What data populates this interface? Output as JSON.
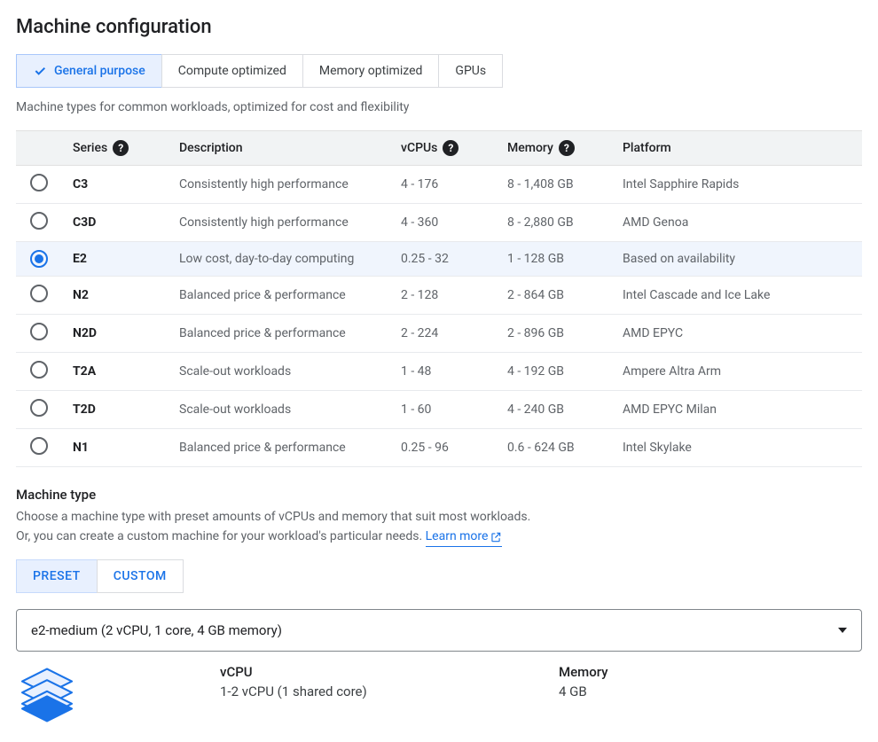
{
  "title": "Machine configuration",
  "tabs": [
    {
      "label": "General purpose",
      "active": true
    },
    {
      "label": "Compute optimized",
      "active": false
    },
    {
      "label": "Memory optimized",
      "active": false
    },
    {
      "label": "GPUs",
      "active": false
    }
  ],
  "subheading": "Machine types for common workloads, optimized for cost and flexibility",
  "table": {
    "headers": {
      "series": "Series",
      "description": "Description",
      "vcpus": "vCPUs",
      "memory": "Memory",
      "platform": "Platform"
    },
    "rows": [
      {
        "series": "C3",
        "description": "Consistently high performance",
        "vcpus": "4 - 176",
        "memory": "8 - 1,408 GB",
        "platform": "Intel Sapphire Rapids",
        "selected": false
      },
      {
        "series": "C3D",
        "description": "Consistently high performance",
        "vcpus": "4 - 360",
        "memory": "8 - 2,880 GB",
        "platform": "AMD Genoa",
        "selected": false
      },
      {
        "series": "E2",
        "description": "Low cost, day-to-day computing",
        "vcpus": "0.25 - 32",
        "memory": "1 - 128 GB",
        "platform": "Based on availability",
        "selected": true
      },
      {
        "series": "N2",
        "description": "Balanced price & performance",
        "vcpus": "2 - 128",
        "memory": "2 - 864 GB",
        "platform": "Intel Cascade and Ice Lake",
        "selected": false
      },
      {
        "series": "N2D",
        "description": "Balanced price & performance",
        "vcpus": "2 - 224",
        "memory": "2 - 896 GB",
        "platform": "AMD EPYC",
        "selected": false
      },
      {
        "series": "T2A",
        "description": "Scale-out workloads",
        "vcpus": "1 - 48",
        "memory": "4 - 192 GB",
        "platform": "Ampere Altra Arm",
        "selected": false
      },
      {
        "series": "T2D",
        "description": "Scale-out workloads",
        "vcpus": "1 - 60",
        "memory": "4 - 240 GB",
        "platform": "AMD EPYC Milan",
        "selected": false
      },
      {
        "series": "N1",
        "description": "Balanced price & performance",
        "vcpus": "0.25 - 96",
        "memory": "0.6 - 624 GB",
        "platform": "Intel Skylake",
        "selected": false
      }
    ]
  },
  "machineType": {
    "label": "Machine type",
    "desc1": "Choose a machine type with preset amounts of vCPUs and memory that suit most workloads.",
    "desc2": "Or, you can create a custom machine for your workload's particular needs.",
    "learnMore": "Learn more",
    "segments": [
      {
        "label": "PRESET",
        "active": true
      },
      {
        "label": "CUSTOM",
        "active": false
      }
    ],
    "dropdownValue": "e2-medium (2 vCPU, 1 core, 4 GB memory)",
    "summary": {
      "vcpu": {
        "label": "vCPU",
        "value": "1-2 vCPU (1 shared core)"
      },
      "memory": {
        "label": "Memory",
        "value": "4 GB"
      }
    }
  }
}
